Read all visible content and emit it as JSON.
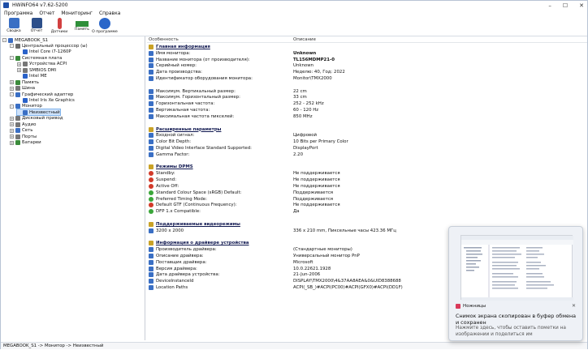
{
  "window": {
    "title": "HWiNFO64 v7.62-5200"
  },
  "menu": [
    "Программа",
    "Отчет",
    "Мониторинг",
    "Справка"
  ],
  "toolbar": [
    {
      "label": "Сводка",
      "icon": "summary-icon",
      "color": "#3a6fc4"
    },
    {
      "label": "Отчет",
      "icon": "save-icon",
      "color": "#2d4f8a"
    },
    {
      "label": "Датчики",
      "icon": "thermometer-icon",
      "color": "#d24040"
    },
    {
      "label": "Память",
      "icon": "memory-icon",
      "color": "#2f8f3a"
    },
    {
      "label": "О программе",
      "icon": "info-icon",
      "color": "#2a66c9"
    }
  ],
  "tree": [
    {
      "label": "MEGABOOK_S1",
      "level": 0,
      "expander": "-",
      "color": "#3b6cc1"
    },
    {
      "label": "Центральный процессор (ы)",
      "level": 1,
      "expander": "-",
      "color": "#6a6a6a"
    },
    {
      "label": "Intel Core i7-1260P",
      "level": 2,
      "expander": "",
      "color": "#2a62c9"
    },
    {
      "label": "Системная плата",
      "level": 1,
      "expander": "-",
      "color": "#3b8b3b"
    },
    {
      "label": "Устройства ACPI",
      "level": 2,
      "expander": "+",
      "color": "#777"
    },
    {
      "label": "SMBIOS DMI",
      "level": 2,
      "expander": "+",
      "color": "#777"
    },
    {
      "label": "Intel ME",
      "level": 2,
      "expander": "",
      "color": "#2a62c9"
    },
    {
      "label": "Память",
      "level": 1,
      "expander": "+",
      "color": "#3b8b3b"
    },
    {
      "label": "Шина",
      "level": 1,
      "expander": "+",
      "color": "#777"
    },
    {
      "label": "Графический адаптер",
      "level": 1,
      "expander": "-",
      "color": "#3a6fc4"
    },
    {
      "label": "Intel Iris Xe Graphics",
      "level": 2,
      "expander": "",
      "color": "#2a62c9"
    },
    {
      "label": "Монитор",
      "level": 1,
      "expander": "-",
      "color": "#3a6fc4"
    },
    {
      "label": "Неизвестный",
      "level": 2,
      "expander": "",
      "color": "#3a6fc4",
      "selected": true
    },
    {
      "label": "Дисковый привод",
      "level": 1,
      "expander": "+",
      "color": "#777"
    },
    {
      "label": "Аудио",
      "level": 1,
      "expander": "+",
      "color": "#777"
    },
    {
      "label": "Сеть",
      "level": 1,
      "expander": "+",
      "color": "#3a6fc4"
    },
    {
      "label": "Порты",
      "level": 1,
      "expander": "+",
      "color": "#777"
    },
    {
      "label": "Батареи",
      "level": 1,
      "expander": "+",
      "color": "#3b8b3b"
    }
  ],
  "columns": {
    "feature": "Особенность",
    "description": "Описание"
  },
  "rows": [
    {
      "k": "Главная информация",
      "type": "section",
      "icon": "monitor-icon",
      "color": "#c9a227"
    },
    {
      "k": "Имя монитора:",
      "v": "Unknown",
      "bold": true,
      "icon": "monitor-icon",
      "color": "#3a6fc4"
    },
    {
      "k": "Название монитора (от производителя):",
      "v": "TL156MDMP21-0",
      "bold": true,
      "icon": "monitor-icon",
      "color": "#3a6fc4"
    },
    {
      "k": "Серийный номер:",
      "v": "Unknown",
      "icon": "monitor-icon",
      "color": "#3a6fc4"
    },
    {
      "k": "Дата производства:",
      "v": "Неделю: 40, Год: 2022",
      "icon": "monitor-icon",
      "color": "#3a6fc4"
    },
    {
      "k": "Идентификатор оборудования монитора:",
      "v": "Monitor\\TMX2000",
      "icon": "monitor-icon",
      "color": "#3a6fc4"
    },
    {
      "k": "",
      "v": "",
      "type": "gap"
    },
    {
      "k": "Максимум. Вертикальный размер:",
      "v": "22 cm",
      "icon": "monitor-icon",
      "color": "#3a6fc4"
    },
    {
      "k": "Максимум. Горизонтальный размер:",
      "v": "33 cm",
      "icon": "monitor-icon",
      "color": "#3a6fc4"
    },
    {
      "k": "Горизонтальная частота:",
      "v": "252 - 252 kHz",
      "icon": "monitor-icon",
      "color": "#3a6fc4"
    },
    {
      "k": "Вертикальная частота:",
      "v": "60 - 120 Hz",
      "icon": "monitor-icon",
      "color": "#3a6fc4"
    },
    {
      "k": "Максимальная частота пикселей:",
      "v": "850 MHz",
      "icon": "monitor-icon",
      "color": "#3a6fc4"
    },
    {
      "k": "",
      "v": "",
      "type": "gap"
    },
    {
      "k": "Расширенные параметры",
      "type": "section",
      "icon": "monitor-icon",
      "color": "#c9a227"
    },
    {
      "k": "Входной сигнал:",
      "v": "Цифровой",
      "icon": "monitor-icon",
      "color": "#3a6fc4"
    },
    {
      "k": "Color Bit Depth:",
      "v": "10 Bits per Primary Color",
      "icon": "monitor-icon",
      "color": "#3a6fc4"
    },
    {
      "k": "Digital Video Interface Standard Supported:",
      "v": "DisplayPort",
      "icon": "monitor-icon",
      "color": "#3a6fc4"
    },
    {
      "k": "Gamma Factor:",
      "v": "2.20",
      "icon": "monitor-icon",
      "color": "#3a6fc4"
    },
    {
      "k": "",
      "v": "",
      "type": "gap"
    },
    {
      "k": "Режимы DPMS",
      "type": "section",
      "icon": "monitor-icon",
      "color": "#c9a227"
    },
    {
      "k": "Standby:",
      "v": "Не поддерживается",
      "icon": "no-icon",
      "color": "#d23a2a"
    },
    {
      "k": "Suspend:",
      "v": "Не поддерживается",
      "icon": "no-icon",
      "color": "#d23a2a"
    },
    {
      "k": "Active Off:",
      "v": "Не поддерживается",
      "icon": "no-icon",
      "color": "#d23a2a"
    },
    {
      "k": "Standard Colour Space (sRGB) Default:",
      "v": "Поддерживается",
      "icon": "yes-icon",
      "color": "#3aa63a"
    },
    {
      "k": "Preferred Timing Mode:",
      "v": "Поддерживается",
      "icon": "yes-icon",
      "color": "#3aa63a"
    },
    {
      "k": "Default GTF (Continuous Frequency):",
      "v": "Не поддерживается",
      "icon": "no-icon",
      "color": "#d23a2a"
    },
    {
      "k": "DFP 1.x Compatible:",
      "v": "Да",
      "icon": "yes-icon",
      "color": "#3aa63a"
    },
    {
      "k": "",
      "v": "",
      "type": "gap"
    },
    {
      "k": "Поддерживаемые видеорежимы",
      "type": "section",
      "icon": "monitor-icon",
      "color": "#c9a227"
    },
    {
      "k": "3200 x 2000",
      "v": "336 x 210 mm, Пиксельные часы 423.36 МГц",
      "icon": "monitor-icon",
      "color": "#3a6fc4"
    },
    {
      "k": "",
      "v": "",
      "type": "gap"
    },
    {
      "k": "Информация о драйвере устройства",
      "type": "section",
      "icon": "monitor-icon",
      "color": "#c9a227"
    },
    {
      "k": "Производитель драйвера:",
      "v": "(Стандартные мониторы)",
      "icon": "monitor-icon",
      "color": "#3a6fc4"
    },
    {
      "k": "Описание драйвера:",
      "v": "Универсальный монитор PnP",
      "icon": "monitor-icon",
      "color": "#3a6fc4"
    },
    {
      "k": "Поставщик драйвера:",
      "v": "Microsoft",
      "icon": "monitor-icon",
      "color": "#3a6fc4"
    },
    {
      "k": "Версия драйвера:",
      "v": "10.0.22621.1928",
      "icon": "monitor-icon",
      "color": "#3a6fc4"
    },
    {
      "k": "Дата драйвера устройства:",
      "v": "21-Jun-2006",
      "icon": "monitor-icon",
      "color": "#3a6fc4"
    },
    {
      "k": "DeviceInstanceId",
      "v": "DISPLAY\\TMX2000\\4&37AA8AEA&0&UID8388688",
      "icon": "monitor-icon",
      "color": "#3a6fc4"
    },
    {
      "k": "Location Paths",
      "v": "ACPI(_SB_)#ACPI(PC00)#ACPI(GFX0)#ACPI(DD1F)",
      "icon": "monitor-icon",
      "color": "#3a6fc4"
    }
  ],
  "status": "MEGABOOK_S1 -> Монитор -> Неизвестный",
  "toast": {
    "app": "Ножницы",
    "title": "Снимок экрана скопирован в буфер обмена и сохранен",
    "body": "Нажмите здесь, чтобы оставить пометки на изображении и поделиться им",
    "close": "✕"
  }
}
